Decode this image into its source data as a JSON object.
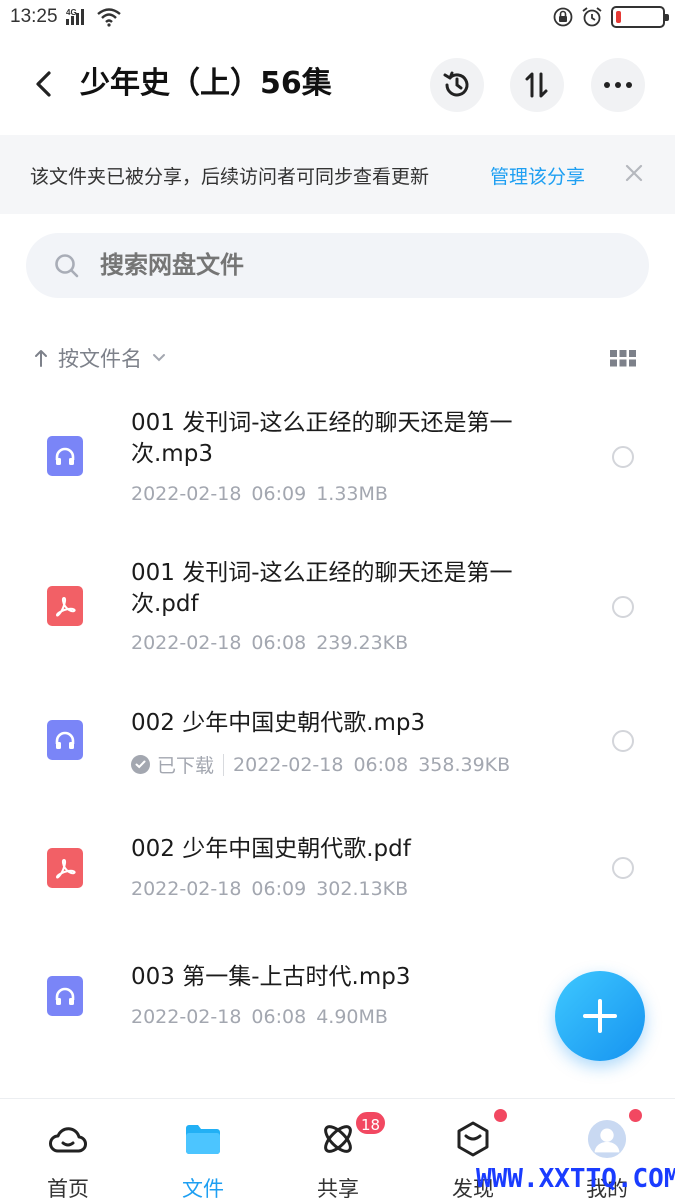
{
  "status_bar": {
    "time": "13:25",
    "network": "4G"
  },
  "header": {
    "title": "少年史（上）56集",
    "icons": [
      "back-icon",
      "history-icon",
      "sort-icon",
      "more-icon"
    ]
  },
  "share_banner": {
    "text": "该文件夹已被分享，后续访问者可同步查看更新",
    "manage_label": "管理该分享"
  },
  "search": {
    "placeholder": "搜索网盘文件"
  },
  "sort": {
    "label": "按文件名"
  },
  "files": [
    {
      "name": "001 发刊词-这么正经的聊天还是第一次.mp3",
      "type": "audio",
      "date": "2022-02-18",
      "time": "06:09",
      "size": "1.33MB",
      "downloaded": false
    },
    {
      "name": "001 发刊词-这么正经的聊天还是第一次.pdf",
      "type": "pdf",
      "date": "2022-02-18",
      "time": "06:08",
      "size": "239.23KB",
      "downloaded": false
    },
    {
      "name": "002 少年中国史朝代歌.mp3",
      "type": "audio",
      "date": "2022-02-18",
      "time": "06:08",
      "size": "358.39KB",
      "downloaded": true,
      "downloaded_label": "已下载"
    },
    {
      "name": "002 少年中国史朝代歌.pdf",
      "type": "pdf",
      "date": "2022-02-18",
      "time": "06:09",
      "size": "302.13KB",
      "downloaded": false
    },
    {
      "name": "003 第一集-上古时代.mp3",
      "type": "audio",
      "date": "2022-02-18",
      "time": "06:08",
      "size": "4.90MB",
      "downloaded": false
    }
  ],
  "bottom_nav": [
    {
      "label": "首页",
      "icon": "cloud-icon",
      "active": false
    },
    {
      "label": "文件",
      "icon": "folder-icon",
      "active": true
    },
    {
      "label": "共享",
      "icon": "share-orbit-icon",
      "active": false,
      "badge": "18"
    },
    {
      "label": "发现",
      "icon": "discover-icon",
      "active": false
    },
    {
      "label": "我的",
      "icon": "avatar-icon",
      "active": false
    }
  ],
  "colors": {
    "accent": "#1e9ff2",
    "audio_icon": "#7a85f7",
    "pdf_icon": "#f26066",
    "badge": "#f24861"
  },
  "watermark": "WWW.XXTTQ.COM"
}
